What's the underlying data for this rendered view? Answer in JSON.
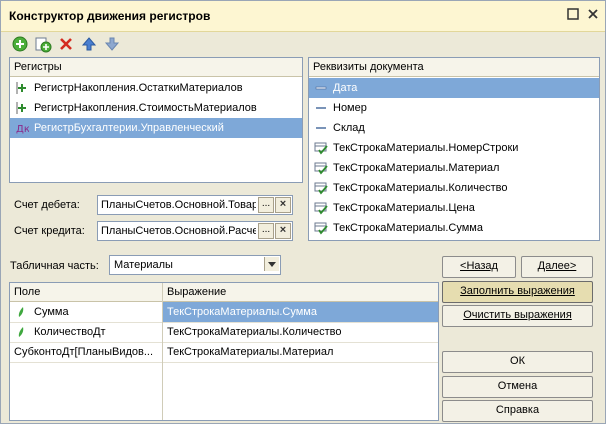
{
  "window": {
    "title": "Конструктор движения регистров"
  },
  "registers": {
    "header": "Регистры",
    "items": [
      {
        "label": "РегистрНакопления.ОстаткиМатериалов",
        "icon": "accumulation-register-icon",
        "selected": false
      },
      {
        "label": "РегистрНакопления.СтоимостьМатериалов",
        "icon": "accumulation-register-icon",
        "selected": false
      },
      {
        "label": "РегистрБухгалтерии.Управленческий",
        "icon": "accounting-register-icon",
        "selected": true
      }
    ]
  },
  "attributes": {
    "header": "Реквизиты документа",
    "items": [
      {
        "label": "Дата",
        "icon": "attribute-icon",
        "selected": true
      },
      {
        "label": "Номер",
        "icon": "attribute-icon",
        "selected": false
      },
      {
        "label": "Склад",
        "icon": "attribute-icon",
        "selected": false
      },
      {
        "label": "ТекСтрокаМатериалы.НомерСтроки",
        "icon": "table-attribute-icon",
        "selected": false
      },
      {
        "label": "ТекСтрокаМатериалы.Материал",
        "icon": "table-attribute-icon",
        "selected": false
      },
      {
        "label": "ТекСтрокаМатериалы.Количество",
        "icon": "table-attribute-icon",
        "selected": false
      },
      {
        "label": "ТекСтрокаМатериалы.Цена",
        "icon": "table-attribute-icon",
        "selected": false
      },
      {
        "label": "ТекСтрокаМатериалы.Сумма",
        "icon": "table-attribute-icon",
        "selected": false
      }
    ]
  },
  "accounts": {
    "debit_label": "Счет дебета:",
    "debit_value": "ПланыСчетов.Основной.Товары",
    "credit_label": "Счет кредита:",
    "credit_value": "ПланыСчетов.Основной.Расчеты",
    "dots": "...",
    "clear": "×"
  },
  "tabular": {
    "label": "Табличная часть:",
    "value": "Материалы"
  },
  "nav": {
    "back": "<Назад",
    "next": "Далее>"
  },
  "grid": {
    "col_field": "Поле",
    "col_expr": "Выражение",
    "rows": [
      {
        "field": "Сумма",
        "expr": "ТекСтрокаМатериалы.Сумма",
        "icon": "resource-icon",
        "selected": true
      },
      {
        "field": "КоличествоДт",
        "expr": "ТекСтрокаМатериалы.Количество",
        "icon": "resource-icon",
        "selected": false
      },
      {
        "field": "СубконтоДт[ПланыВидов...",
        "expr": "ТекСтрокаМатериалы.Материал",
        "icon": "",
        "selected": false
      }
    ]
  },
  "actions": {
    "fill": "Заполнить выражения",
    "clear": "Очистить выражения",
    "ok": "ОК",
    "cancel": "Отмена",
    "help": "Справка"
  },
  "colors": {
    "title_bg": "#fdf6d2",
    "selection": "#7ea8d8",
    "dialog_bg": "#ece9d8"
  }
}
